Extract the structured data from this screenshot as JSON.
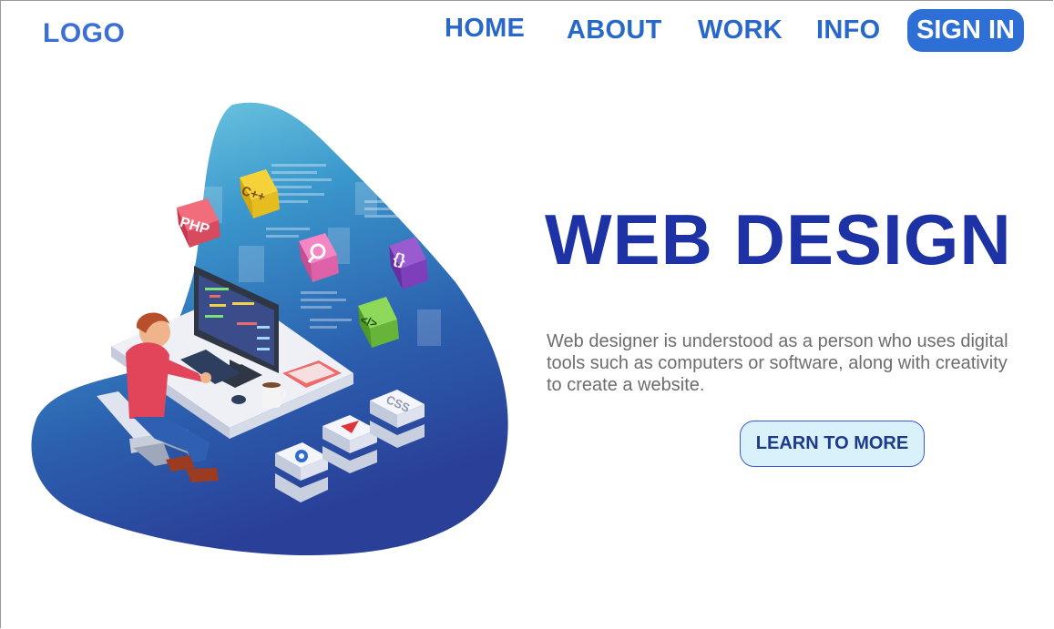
{
  "header": {
    "logo": "LOGO",
    "nav": [
      "HOME",
      "ABOUT",
      "WORK",
      "INFO"
    ],
    "signin": "SIGN IN"
  },
  "hero": {
    "title": "WEB DESIGN",
    "description": "Web designer is understood as a person who uses digital tools such as computers or software, along with creativity to create a website.",
    "cta": "LEARN TO MORE"
  },
  "illustration": {
    "badges": [
      "PHP",
      "C++",
      "{}",
      "</>",
      "CSS"
    ]
  },
  "colors": {
    "brand_blue": "#2e6fd6",
    "headline_blue": "#1d32a4",
    "cta_bg": "#d8f1fb"
  }
}
